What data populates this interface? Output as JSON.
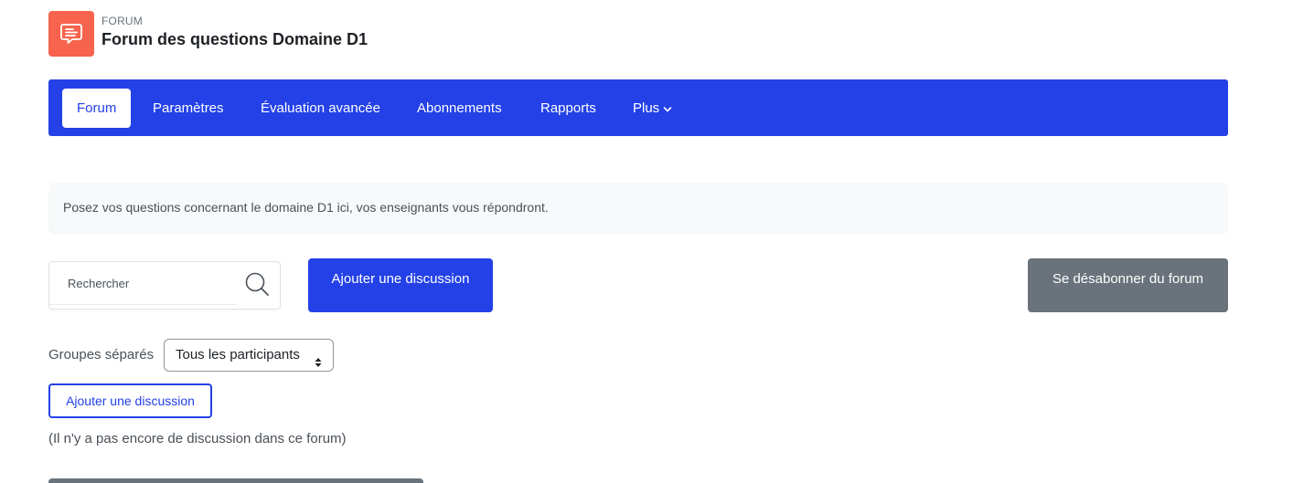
{
  "header": {
    "module_type": "FORUM",
    "title": "Forum des questions Domaine D1",
    "icon": "forum-chat-icon",
    "icon_color": "#f7634d"
  },
  "nav": {
    "items": [
      {
        "label": "Forum",
        "active": true
      },
      {
        "label": "Paramètres",
        "active": false
      },
      {
        "label": "Évaluation avancée",
        "active": false
      },
      {
        "label": "Abonnements",
        "active": false
      },
      {
        "label": "Rapports",
        "active": false
      },
      {
        "label": "Plus",
        "active": false,
        "icon": "chevron-down-icon"
      }
    ],
    "background": "#2441e7"
  },
  "intro": {
    "text": "Posez vos questions concernant le domaine D1 ici, vos enseignants vous répondront."
  },
  "search": {
    "placeholder": "Rechercher",
    "value": "",
    "icon": "search-icon"
  },
  "actions": {
    "add_discussion": "Ajouter une discussion",
    "unsubscribe": "Se désabonner du forum"
  },
  "groups": {
    "label": "Groupes séparés",
    "selected": "Tous les participants"
  },
  "secondary_add_discussion": "Ajouter une discussion",
  "empty_message": "(Il n'y a pas encore de discussion dans ce forum)",
  "colors": {
    "primary": "#2441e7",
    "secondary": "#6a737b"
  }
}
